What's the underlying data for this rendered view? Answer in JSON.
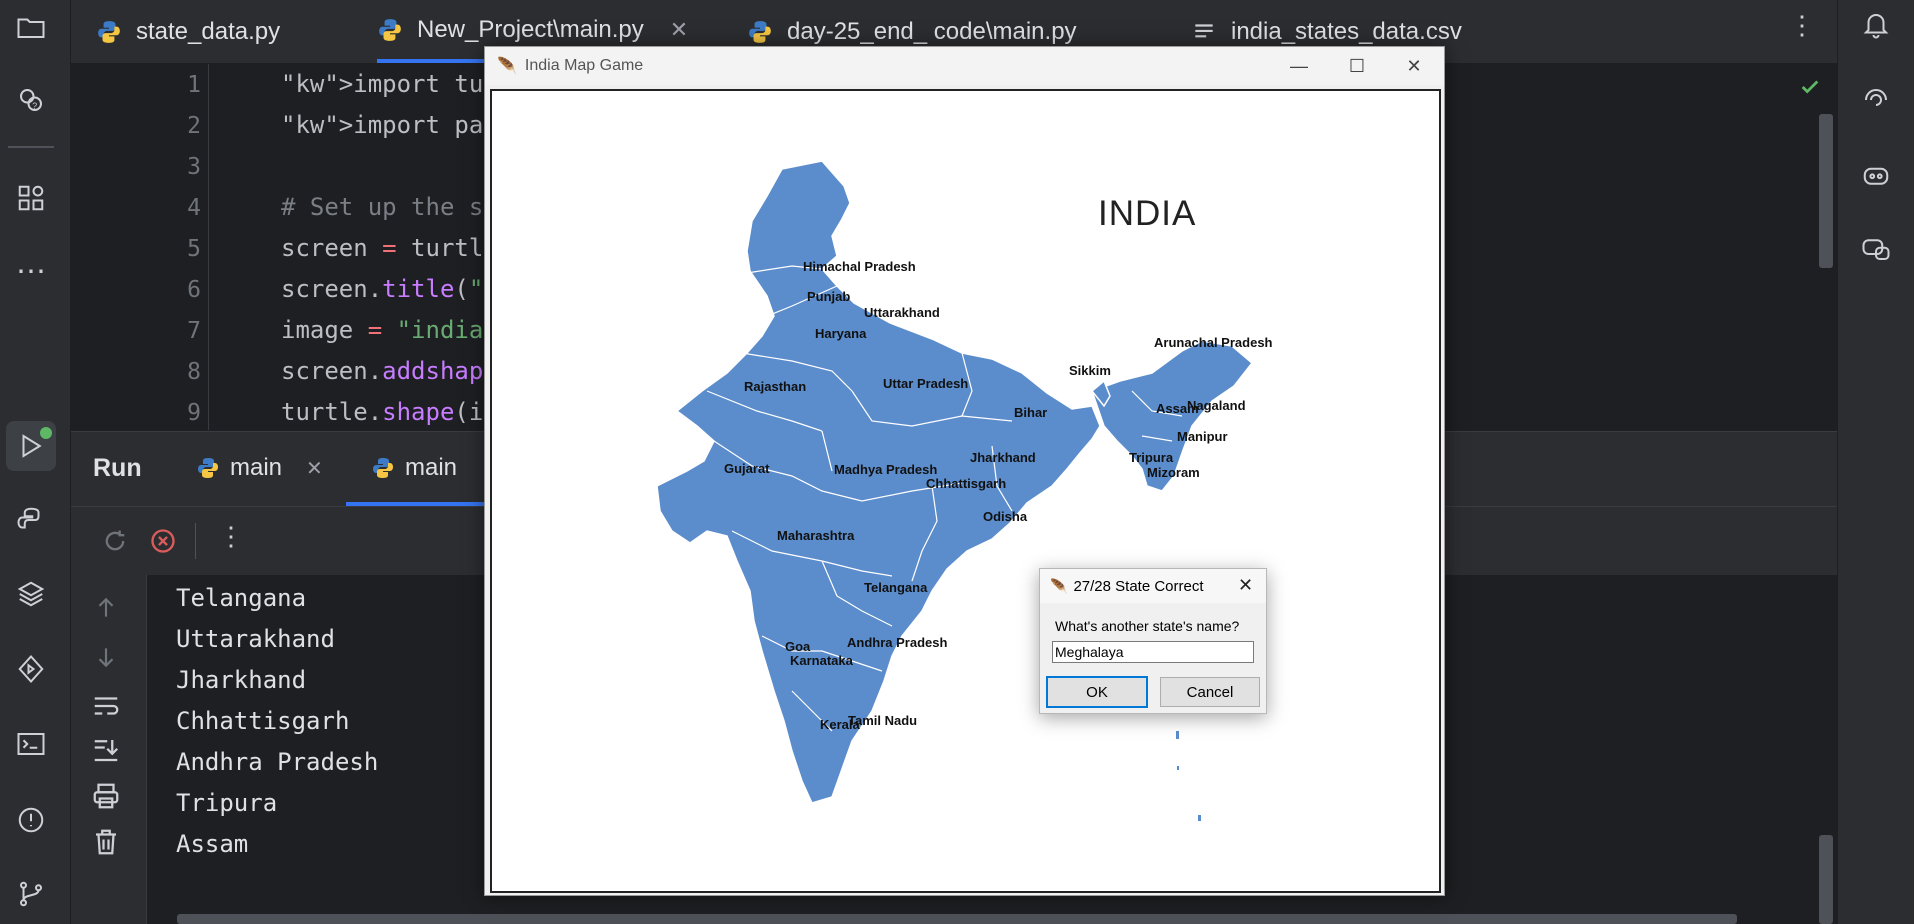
{
  "editor_tabs": [
    {
      "label": "state_data.py",
      "icon": "python-icon"
    },
    {
      "label": "New_Project\\main.py",
      "icon": "python-icon",
      "active": true,
      "close": "✕"
    },
    {
      "label": "day-25_end_ code\\main.py",
      "icon": "python-icon"
    },
    {
      "label": "india_states_data.csv",
      "icon": "text-file-icon"
    }
  ],
  "code_lines": [
    {
      "n": "1",
      "text": "import turtle"
    },
    {
      "n": "2",
      "text": "import pandas"
    },
    {
      "n": "3",
      "text": ""
    },
    {
      "n": "4",
      "text": "# Set up the screen"
    },
    {
      "n": "5",
      "text": "screen = turtle.Screen()"
    },
    {
      "n": "6",
      "text": "screen.title(\"India"
    },
    {
      "n": "7",
      "text": "image = \"india-map"
    },
    {
      "n": "8",
      "text": "screen.addshape(ima"
    },
    {
      "n": "9",
      "text": "turtle.shape(image)"
    }
  ],
  "run_panel": {
    "title": "Run",
    "tabs": [
      {
        "label": "main",
        "close": "✕"
      },
      {
        "label": "main",
        "active": true
      }
    ]
  },
  "console_output": [
    "Telangana",
    "Uttarakhand",
    "Jharkhand",
    "Chhattisgarh",
    "Andhra Pradesh",
    "Tripura",
    "Assam"
  ],
  "game_window": {
    "title": "India Map Game",
    "map_title": "INDIA",
    "state_labels": [
      {
        "name": "Himachal Pradesh"
      },
      {
        "name": "Punjab"
      },
      {
        "name": "Uttarakhand"
      },
      {
        "name": "Haryana"
      },
      {
        "name": "Rajasthan"
      },
      {
        "name": "Uttar Pradesh"
      },
      {
        "name": "Sikkim"
      },
      {
        "name": "Arunachal Pradesh"
      },
      {
        "name": "Assam"
      },
      {
        "name": "Nagaland"
      },
      {
        "name": "Bihar"
      },
      {
        "name": "Manipur"
      },
      {
        "name": "Gujarat"
      },
      {
        "name": "Madhya Pradesh"
      },
      {
        "name": "Jharkhand"
      },
      {
        "name": "Tripura"
      },
      {
        "name": "Mizoram"
      },
      {
        "name": "Chhattisgarh"
      },
      {
        "name": "Odisha"
      },
      {
        "name": "Maharashtra"
      },
      {
        "name": "Telangana"
      },
      {
        "name": "Goa"
      },
      {
        "name": "Andhra Pradesh"
      },
      {
        "name": "Karnataka"
      },
      {
        "name": "Tamil Nadu"
      },
      {
        "name": "Kerala"
      }
    ],
    "map_color": "#5b8ccb"
  },
  "dialog": {
    "title": "27/28 State Correct",
    "prompt": "What's another state's name?",
    "input_value": "Meghalaya",
    "ok_label": "OK",
    "cancel_label": "Cancel"
  },
  "colors": {
    "accent": "#3574f0",
    "run_green": "#5fb865",
    "stop_red": "#db5c5c"
  }
}
